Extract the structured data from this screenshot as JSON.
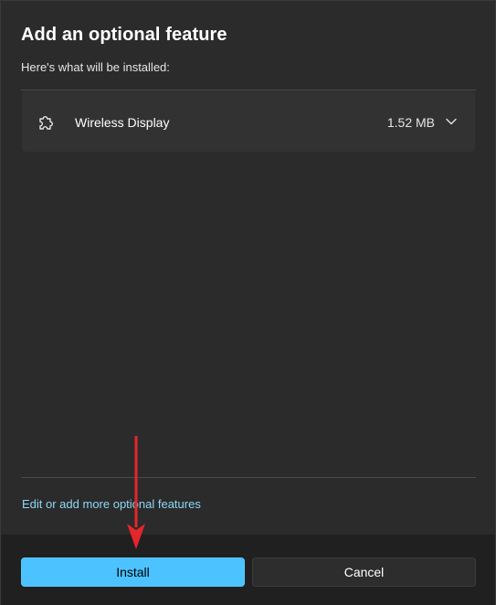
{
  "dialog": {
    "title": "Add an optional feature",
    "subtitle": "Here's what will be installed:",
    "feature": {
      "icon": "puzzle-piece-icon",
      "name": "Wireless Display",
      "size": "1.52 MB"
    },
    "link_text": "Edit or add more optional features",
    "buttons": {
      "install": "Install",
      "cancel": "Cancel"
    }
  },
  "colors": {
    "background": "#2b2b2b",
    "card": "#323232",
    "footer": "#202020",
    "accent": "#4cc2ff",
    "link": "#8fd8f5",
    "annotation_arrow": "#e5262b"
  }
}
